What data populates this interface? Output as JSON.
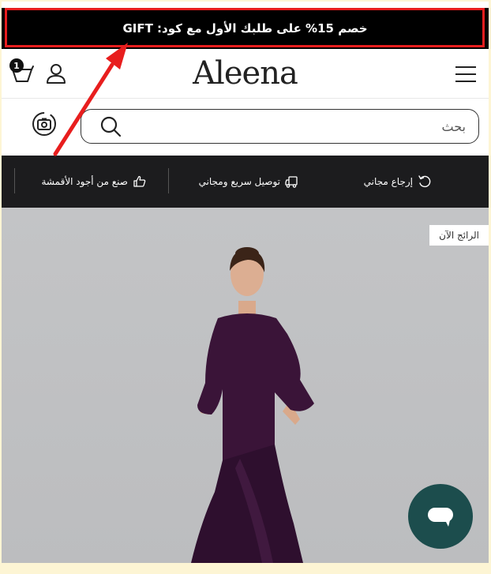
{
  "promo": {
    "text": "خصم 15% على طلبك الأول مع كود: GIFT"
  },
  "header": {
    "brand": "Aleena",
    "cart_count": "1"
  },
  "search": {
    "placeholder": "بحث"
  },
  "features": {
    "items": [
      {
        "label": "إرجاع مجاني",
        "icon": "return-icon"
      },
      {
        "label": "توصيل سريع ومجاني",
        "icon": "truck-icon"
      },
      {
        "label": "صنع من أجود الأقمشة",
        "icon": "thumbs-up-icon"
      }
    ]
  },
  "hero": {
    "tag": "الرائج الآن"
  },
  "colors": {
    "promo_bg": "#000000",
    "highlight": "#e81e1e",
    "features_bg": "#1c1c1e",
    "chat_bg": "#1c4d4d",
    "dress": "#3a1438"
  }
}
